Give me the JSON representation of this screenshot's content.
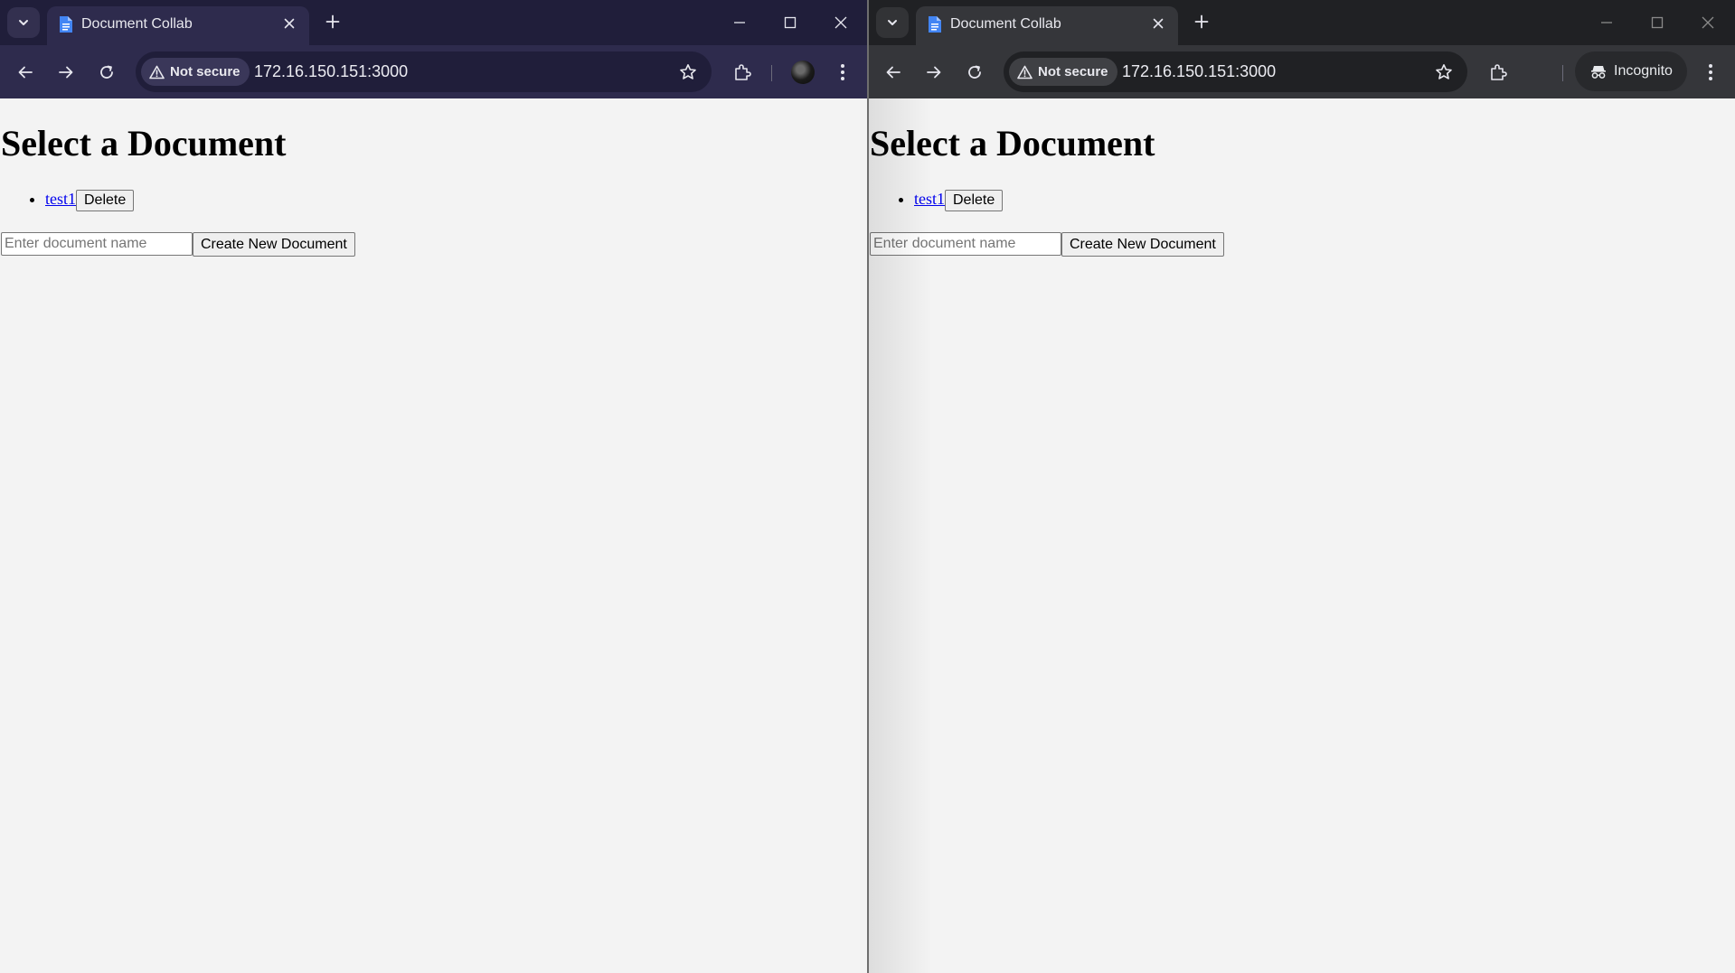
{
  "windows": [
    {
      "id": "left",
      "tab": {
        "title": "Document Collab",
        "favicon": "docs-icon"
      },
      "address": {
        "security_label": "Not secure",
        "url": "172.16.150.151:3000"
      },
      "profile": "avatar",
      "page": {
        "heading": "Select a Document",
        "documents": [
          {
            "name": "test1",
            "delete_label": "Delete"
          }
        ],
        "new_doc_placeholder": "Enter document name",
        "create_label": "Create New Document"
      }
    },
    {
      "id": "right",
      "tab": {
        "title": "Document Collab",
        "favicon": "docs-icon"
      },
      "address": {
        "security_label": "Not secure",
        "url": "172.16.150.151:3000"
      },
      "profile": {
        "incognito_label": "Incognito"
      },
      "page": {
        "heading": "Select a Document",
        "documents": [
          {
            "name": "test1",
            "delete_label": "Delete"
          }
        ],
        "new_doc_placeholder": "Enter document name",
        "create_label": "Create New Document"
      }
    }
  ],
  "colors": {
    "left_tabbar": "#201e3a",
    "left_toolbar": "#2e2b4d",
    "right_tabbar": "#202124",
    "right_toolbar": "#35363a",
    "page_bg": "#f3f3f3",
    "link": "#0000ee"
  }
}
